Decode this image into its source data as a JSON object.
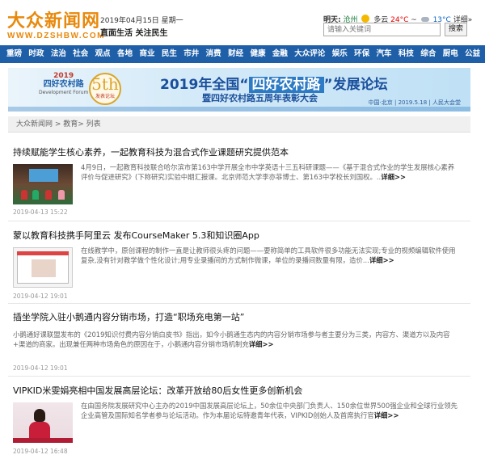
{
  "header": {
    "logo_cn": "大众新闻网",
    "logo_url": "WWW.DZSHBW.COM",
    "date": "2019年04月15日 星期一",
    "slogan": "直面生活  关注民生",
    "weather": {
      "label": "明天:",
      "city": "沧州",
      "condition": "多云",
      "high": "24°C",
      "sep": "~",
      "low": "13°C",
      "detail": "详细»"
    },
    "search": {
      "placeholder": "请输入关键词",
      "button": "搜索"
    }
  },
  "nav": [
    "重磅",
    "时政",
    "法治",
    "社会",
    "观点",
    "各地",
    "商业",
    "民生",
    "市井",
    "消费",
    "财经",
    "健康",
    "金融",
    "大众评论",
    "娱乐",
    "环保",
    "汽车",
    "科技",
    "综合",
    "厨电",
    "公益"
  ],
  "banner": {
    "logo_year": "2019",
    "logo_name": "四好农村路",
    "logo_sub": "Development Forum",
    "badge_num": "5th",
    "badge_sub": "发表论坛",
    "title_pre": "2019年全国“",
    "title_hl": "四好农村路",
    "title_post": "”发展论坛",
    "subtitle": "暨四好农村路五周年表彰大会",
    "meta": "中国·北京 | 2019.5.18 | 人民大会堂"
  },
  "breadcrumb": "大众新闻网 > 教育> 列表",
  "articles": [
    {
      "title": "持续赋能学生核心素养，一起教育科技为混合式作业课题研究提供范本",
      "summary": "4月9日，一起教育科技联合哈尔滨市第163中学开展全市中学英语十三五科研课题——《基于混合式作业的学生发展核心素养评价与促进研究》(下称研究)实验中期汇报课。北京师范大学李亦菲博士、第163中学校长刘国权。..",
      "more": "详细>>",
      "time": "2019-04-13 15:22"
    },
    {
      "title": "蒙以教育科技携手阿里云 发布CourseMaker 5.3和知识圈App",
      "summary": "在线教学中，原创课程的制作一直是让教师很头疼的问题——要称简单的工具软件很多功能无法实现;专业的视频编辑软件使用复杂,没有针对教学做个性化设计;用专业录播间的方式制作微课，单位的录播间数量有限，造价...",
      "more": "详细>>",
      "time": "2019-04-12 19:01"
    },
    {
      "title": "插坐学院入驻小鹅通内容分销市场，打造“职场充电第一站”",
      "summary": "小鹅通好课联盟发布的《2019知识付费内容分销白皮书》指出，如今小鹅通生态内的内容分销市场参与者主要分为三类，内容方、渠道方以及内容+渠道的商家。出现兼任两种市场角色的原因在于，小鹅通内容分销市场机制充",
      "more": "详细>>",
      "time": "2019-04-12 19:01"
    },
    {
      "title": "VIPKID米雯娟亮相中国发展高层论坛：改革开放给80后女性更多创新机会",
      "summary": "在由国务院发展研究中心主办的2019中国发展高层论坛上，50余位中央部门负责人、150余位世界500强企业和全球行业领先企业高管及国际知名学者参与论坛活动。作为本届论坛特邀青年代表，VIPKID创始人及首席执行官",
      "more": "详细>>",
      "time": "2019-04-12 16:48"
    }
  ]
}
